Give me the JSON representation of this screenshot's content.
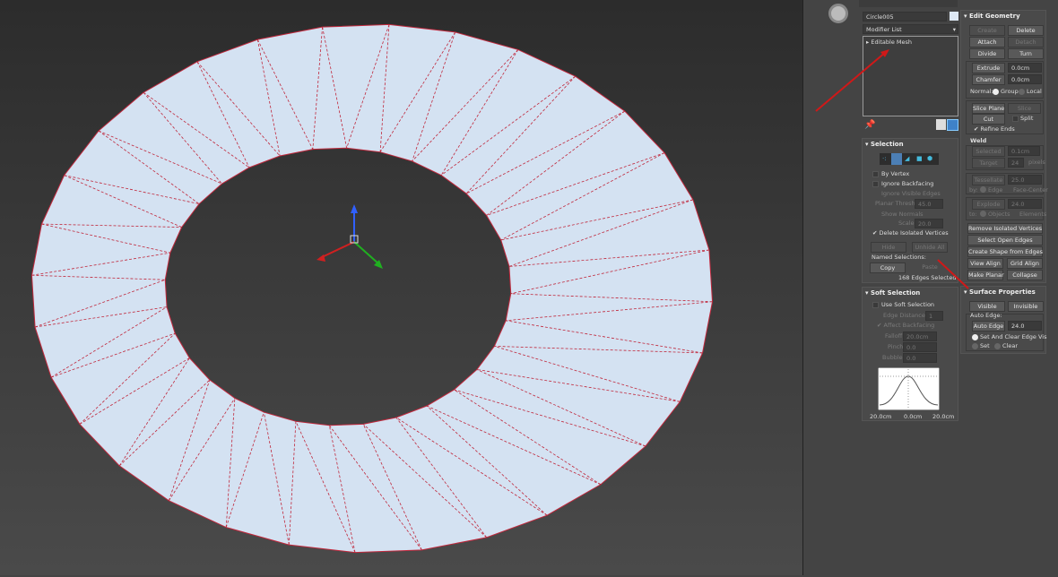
{
  "object_name": "Circle005",
  "modifier_list": "Modifier List",
  "stack_item": "Editable Mesh",
  "edit_geometry": {
    "title": "Edit Geometry",
    "create": "Create",
    "delete": "Delete",
    "attach": "Attach",
    "detach": "Detach",
    "divide": "Divide",
    "turn": "Turn",
    "extrude": "Extrude",
    "extrude_val": "0.0cm",
    "chamfer": "Chamfer",
    "chamfer_val": "0.0cm",
    "normal": "Normal:",
    "group": "Group",
    "local": "Local",
    "slice_plane": "Slice Plane",
    "slice": "Slice",
    "cut": "Cut",
    "split": "Split",
    "refine_ends": "Refine Ends",
    "weld": "Weld",
    "selected": "Selected",
    "selected_val": "0.1cm",
    "target": "Target",
    "target_val": "24",
    "pixels": "pixels",
    "tessellate": "Tessellate",
    "tess_val": "25.0",
    "by": "by:",
    "edge": "Edge",
    "face_center": "Face-Center",
    "explode": "Explode",
    "explode_val": "24.0",
    "to": "to:",
    "objects": "Objects",
    "elements": "Elements",
    "remove_isolated": "Remove Isolated Vertices",
    "select_open": "Select Open Edges",
    "create_shape": "Create Shape from Edges",
    "view_align": "View Align",
    "grid_align": "Grid Align",
    "make_planar": "Make Planar",
    "collapse": "Collapse"
  },
  "selection": {
    "title": "Selection",
    "by_vertex": "By Vertex",
    "ignore_backfacing": "Ignore Backfacing",
    "ignore_visible": "Ignore Visible Edges",
    "planar_thresh": "Planar Thresh:",
    "planar_val": "45.0",
    "show_normals": "Show Normals",
    "scale": "Scale:",
    "scale_val": "20.0",
    "delete_isolated": "Delete Isolated Vertices",
    "hide": "Hide",
    "unhide_all": "Unhide All",
    "named_selections": "Named Selections:",
    "copy": "Copy",
    "paste": "Paste",
    "status": "168 Edges Selected"
  },
  "soft_selection": {
    "title": "Soft Selection",
    "use_soft": "Use Soft Selection",
    "edge_distance": "Edge Distance:",
    "edge_val": "1",
    "affect_backfacing": "Affect Backfacing",
    "falloff": "Falloff:",
    "falloff_val": "20.0cm",
    "pinch": "Pinch:",
    "pinch_val": "0.0",
    "bubble": "Bubble:",
    "bubble_val": "0.0",
    "curve_left": "20.0cm",
    "curve_mid": "0.0cm",
    "curve_right": "20.0cm"
  },
  "surface_properties": {
    "title": "Surface Properties",
    "visible": "Visible",
    "invisible": "Invisible",
    "auto_edge_label": "Auto Edge:",
    "auto_edge_btn": "Auto Edge",
    "auto_edge_val": "24.0",
    "set_clear": "Set And Clear Edge Vis",
    "set": "Set",
    "clear": "Clear"
  },
  "colors": {
    "mesh": "#d4e2f2",
    "edge": "#c0283c",
    "accent": "#5b9bd5"
  }
}
